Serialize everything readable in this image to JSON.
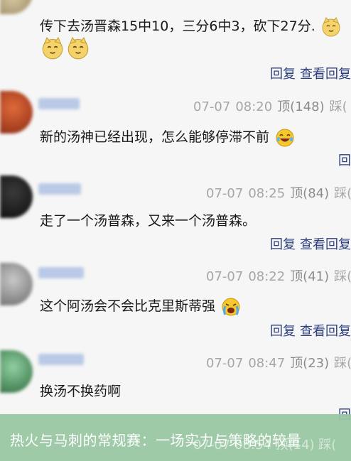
{
  "comments": [
    {
      "text": "传下去汤晋森15中10，三分6中3，砍下27分.",
      "actions": [
        "回复",
        "查看回复"
      ]
    },
    {
      "date": "07-07",
      "time": "08:20",
      "likes_label": "顶(148)",
      "extra": "踩(",
      "text": "新的汤神已经出现，怎么能够停滞不前",
      "actions": [
        "回"
      ]
    },
    {
      "date": "07-07",
      "time": "08:25",
      "likes_label": "顶(84)",
      "extra": "踩(",
      "text": "走了一个汤普森，又来一个汤普森。",
      "actions": [
        "回复",
        "查看回复"
      ]
    },
    {
      "date": "07-07",
      "time": "08:22",
      "likes_label": "顶(41)",
      "extra": "踩(",
      "text": "这个阿汤会不会比克里斯蒂强",
      "actions": [
        "回复",
        "查看回复"
      ]
    },
    {
      "date": "07-07",
      "time": "08:47",
      "likes_label": "顶(23)",
      "extra": "踩(",
      "text": "换汤不换药啊",
      "actions": [
        "回"
      ]
    }
  ],
  "footer": {
    "title": "热火与马刺的常规赛：一场实力与策略的较量",
    "partial_meta": "07-07 08:54 顶(14) 踩("
  },
  "colors": {
    "link": "#2c3e80",
    "meta": "#a6a6a6",
    "banner": "#99c7a3"
  },
  "icons": [
    "cat-face-icon",
    "laughing-tears-icon",
    "crying-face-icon"
  ]
}
